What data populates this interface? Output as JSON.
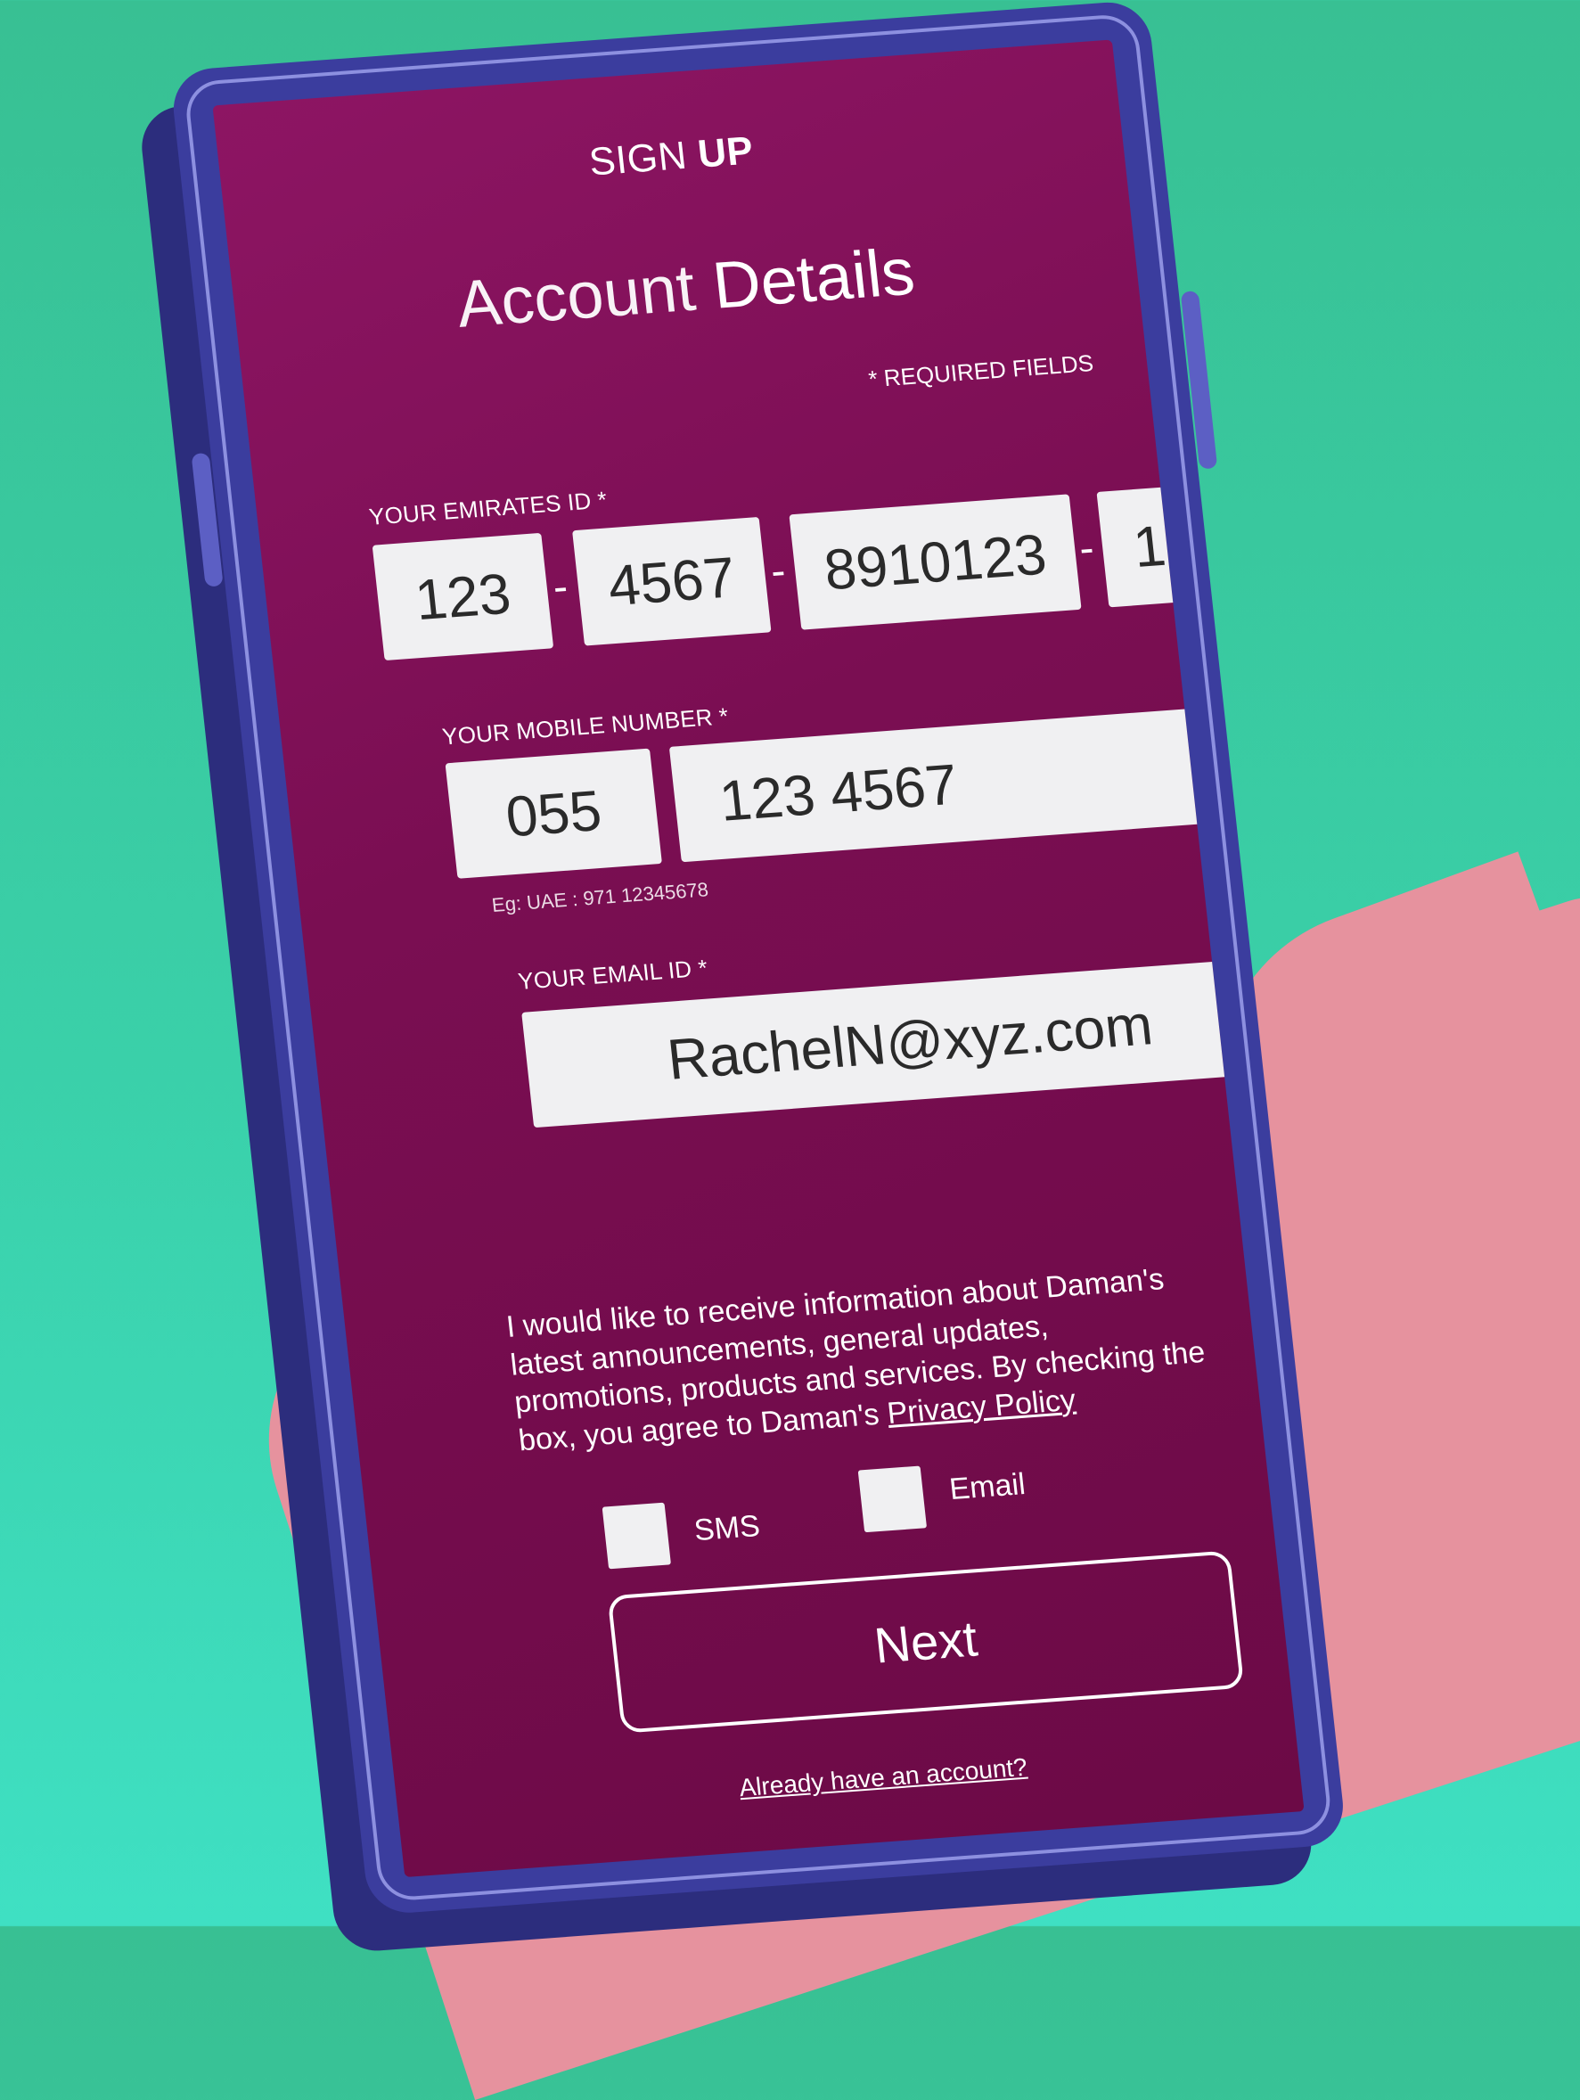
{
  "header": {
    "sign_up_light": "SIGN",
    "sign_up_bold": "UP"
  },
  "title": {
    "light": "Account",
    "bold": "Details"
  },
  "required_note": "* REQUIRED FIELDS",
  "emirates_id": {
    "label": "YOUR EMIRATES ID *",
    "parts": [
      "123",
      "4567",
      "8910123",
      "1"
    ],
    "separator": "-"
  },
  "mobile": {
    "label": "YOUR MOBILE NUMBER *",
    "prefix": "055",
    "number": "123 4567",
    "hint": "Eg: UAE : 971 12345678"
  },
  "email": {
    "label": "YOUR EMAIL ID *",
    "value": "RachelN@xyz.com"
  },
  "consent": {
    "text": "I would like to receive information about Daman's latest announcements, general updates, promotions, products and services. By checking the box, you agree to Daman's",
    "link": "Privacy Policy"
  },
  "checkboxes": {
    "sms_label": "SMS",
    "email_label": "Email"
  },
  "next_label": "Next",
  "already_link": "Already have an account?",
  "colors": {
    "background": "#3ad0a9",
    "phone": "#3b3d9e",
    "screen": "#7a0e52",
    "hand": "#e6929e"
  }
}
